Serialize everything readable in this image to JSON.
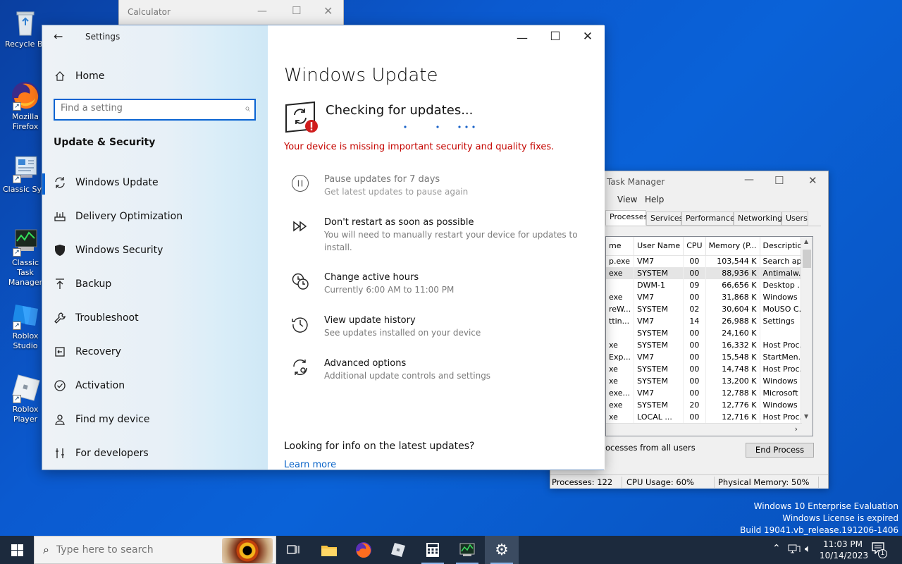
{
  "desktop": {
    "icons": [
      {
        "label": "Recycle Bin"
      },
      {
        "label": "Mozilla Firefox"
      },
      {
        "label": "Classic System Co..."
      },
      {
        "label": "Classic Task Manager"
      },
      {
        "label": "Roblox Studio"
      },
      {
        "label": "Roblox Player"
      }
    ]
  },
  "calculator": {
    "title": "Calculator"
  },
  "settings": {
    "title": "Settings",
    "home": "Home",
    "search_placeholder": "Find a setting",
    "section": "Update & Security",
    "nav": [
      {
        "label": "Windows Update",
        "icon": "refresh-icon"
      },
      {
        "label": "Delivery Optimization",
        "icon": "delivery-icon"
      },
      {
        "label": "Windows Security",
        "icon": "shield-icon"
      },
      {
        "label": "Backup",
        "icon": "backup-arrow-icon"
      },
      {
        "label": "Troubleshoot",
        "icon": "wrench-icon"
      },
      {
        "label": "Recovery",
        "icon": "recovery-icon"
      },
      {
        "label": "Activation",
        "icon": "check-circle-icon"
      },
      {
        "label": "Find my device",
        "icon": "person-pin-icon"
      },
      {
        "label": "For developers",
        "icon": "developer-icon"
      }
    ],
    "main": {
      "heading": "Windows Update",
      "status": "Checking for updates...",
      "warning": "Your device is missing important security and quality fixes.",
      "warning_color": "#c50500",
      "options": [
        {
          "title": "Pause updates for 7 days",
          "subtitle": "Get latest updates to pause again",
          "icon": "pause-icon"
        },
        {
          "title": "Don't restart as soon as possible",
          "subtitle": "You will need to manually restart your device for updates to install.",
          "icon": "fast-forward-icon"
        },
        {
          "title": "Change active hours",
          "subtitle": "Currently 6:00 AM to 11:00 PM",
          "icon": "clock-icon"
        },
        {
          "title": "View update history",
          "subtitle": "See updates installed on your device",
          "icon": "history-icon"
        },
        {
          "title": "Advanced options",
          "subtitle": "Additional update controls and settings",
          "icon": "gear-refresh-icon"
        }
      ],
      "info_heading": "Looking for info on the latest updates?",
      "learn_more": "Learn more"
    }
  },
  "task_manager": {
    "title": "Task Manager",
    "menu": [
      "View",
      "Help"
    ],
    "tabs": [
      "Processes",
      "Services",
      "Performance",
      "Networking",
      "Users"
    ],
    "columns": [
      "me",
      "User Name",
      "CPU",
      "Memory (P...",
      "Description"
    ],
    "rows": [
      [
        "p.exe",
        "VM7",
        "00",
        "103,544 K",
        "Search ap..."
      ],
      [
        "exe",
        "SYSTEM",
        "00",
        "88,936 K",
        "Antimalw..."
      ],
      [
        "",
        "DWM-1",
        "09",
        "66,656 K",
        "Desktop ..."
      ],
      [
        "exe",
        "VM7",
        "00",
        "31,868 K",
        "Windows ..."
      ],
      [
        "reW...",
        "SYSTEM",
        "02",
        "30,604 K",
        "MoUSO C..."
      ],
      [
        "ttin...",
        "VM7",
        "14",
        "26,988 K",
        "Settings"
      ],
      [
        "",
        "SYSTEM",
        "00",
        "24,160 K",
        ""
      ],
      [
        "xe",
        "SYSTEM",
        "00",
        "16,332 K",
        "Host Proc..."
      ],
      [
        "Exp...",
        "VM7",
        "00",
        "15,548 K",
        "StartMen..."
      ],
      [
        "xe",
        "SYSTEM",
        "00",
        "14,748 K",
        "Host Proc..."
      ],
      [
        "xe",
        "SYSTEM",
        "00",
        "13,200 K",
        "Windows ..."
      ],
      [
        "exe...",
        "VM7",
        "00",
        "12,788 K",
        "Microsoft ..."
      ],
      [
        "exe",
        "SYSTEM",
        "20",
        "12,776 K",
        "Windows ..."
      ],
      [
        "xe",
        "LOCAL ...",
        "00",
        "12,716 K",
        "Host Proc..."
      ]
    ],
    "show_all": "ocesses from all users",
    "end_process": "End Process",
    "status": {
      "processes": "Processes: 122",
      "cpu": "CPU Usage: 60%",
      "memory": "Physical Memory: 50%"
    }
  },
  "watermark": {
    "line1": "Windows 10 Enterprise Evaluation",
    "line2": "Windows License is expired",
    "line3": "Build 19041.vb_release.191206-1406"
  },
  "taskbar": {
    "search_placeholder": "Type here to search",
    "time": "11:03 PM",
    "date": "10/14/2023",
    "notification_count": "1"
  }
}
